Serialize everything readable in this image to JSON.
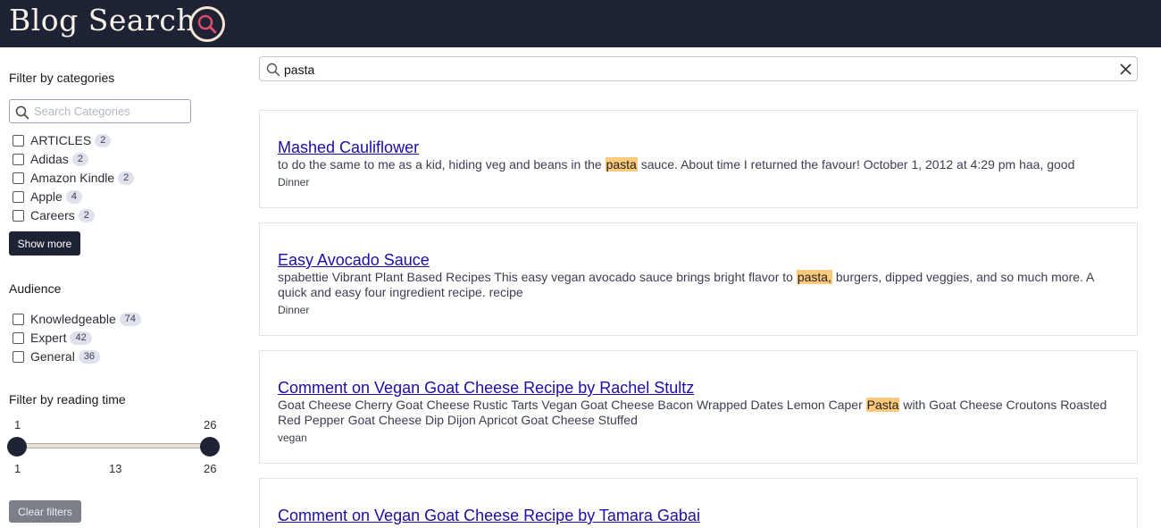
{
  "header": {
    "title": "Blog Search",
    "logo_icon": "search-icon"
  },
  "sidebar": {
    "categories": {
      "title": "Filter by categories",
      "search_placeholder": "Search Categories",
      "items": [
        {
          "label": "ARTICLES",
          "count": "2"
        },
        {
          "label": "Adidas",
          "count": "2"
        },
        {
          "label": "Amazon Kindle",
          "count": "2"
        },
        {
          "label": "Apple",
          "count": "4"
        },
        {
          "label": "Careers",
          "count": "2"
        }
      ],
      "show_more": "Show more"
    },
    "audience": {
      "title": "Audience",
      "items": [
        {
          "label": "Knowledgeable",
          "count": "74"
        },
        {
          "label": "Expert",
          "count": "42"
        },
        {
          "label": "General",
          "count": "36"
        }
      ]
    },
    "reading_time": {
      "title": "Filter by reading time",
      "min_value": "1",
      "max_value": "26",
      "scale_min": "1",
      "scale_mid": "13",
      "scale_max": "26"
    },
    "clear_filters": "Clear filters"
  },
  "search": {
    "query": "pasta"
  },
  "results": [
    {
      "title": "Mashed Cauliflower",
      "snippet_before": "to do the same to me as a kid, hiding veg and beans in the ",
      "highlight": "pasta",
      "snippet_after": " sauce. About time I returned the favour! October 1, 2012 at 4:29 pm haa, good",
      "category": "Dinner"
    },
    {
      "title": "Easy Avocado Sauce",
      "snippet_before": "spabettie Vibrant Plant Based Recipes This easy vegan avocado sauce brings bright flavor to ",
      "highlight": "pasta,",
      "snippet_after": " burgers, dipped veggies, and so much more. A quick and easy four ingredient recipe. recipe",
      "category": "Dinner"
    },
    {
      "title": "Comment on Vegan Goat Cheese Recipe by Rachel Stultz",
      "snippet_before": "Goat Cheese Cherry Goat Cheese Rustic Tarts Vegan Goat Cheese Bacon Wrapped Dates Lemon Caper ",
      "highlight": "Pasta",
      "snippet_after": " with Goat Cheese Croutons Roasted Red Pepper Goat Cheese Dip Dijon Apricot Goat Cheese Stuffed",
      "category": "vegan"
    },
    {
      "title": "Comment on Vegan Goat Cheese Recipe by Tamara Gabai"
    }
  ],
  "colors": {
    "header_bg": "#1e2235",
    "highlight": "#fdc97a",
    "link": "#1a0dab"
  }
}
